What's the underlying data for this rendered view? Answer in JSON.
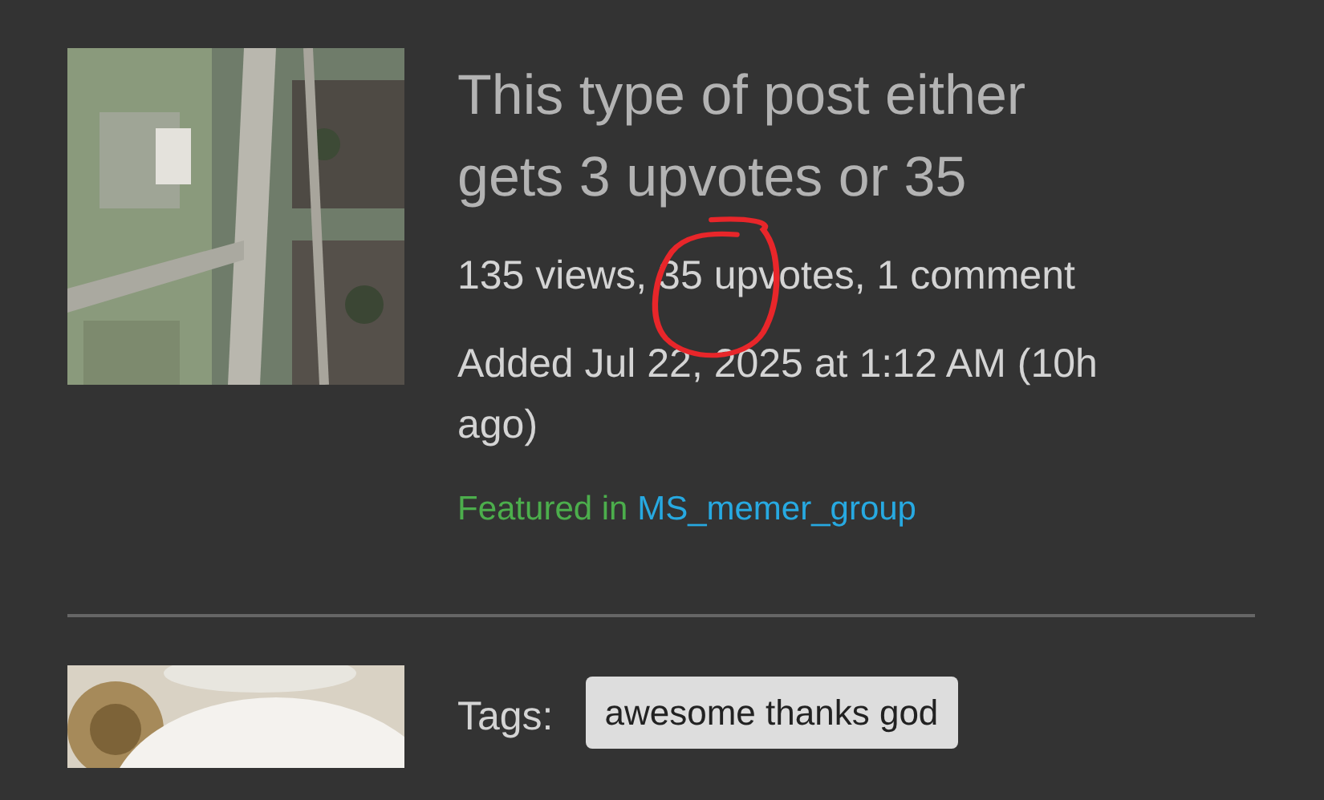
{
  "post": {
    "title": "This type of post either gets 3 upvotes or 35",
    "stats": "135 views, 35 upvotes, 1 comment",
    "added": "Added Jul 22, 2025 at 1:12 AM (10h ago)",
    "featured": {
      "label": "Featured in",
      "group": "MS_memer_group"
    }
  },
  "next_post": {
    "tags_label": "Tags:",
    "tags": [
      "awesome thanks god"
    ]
  }
}
